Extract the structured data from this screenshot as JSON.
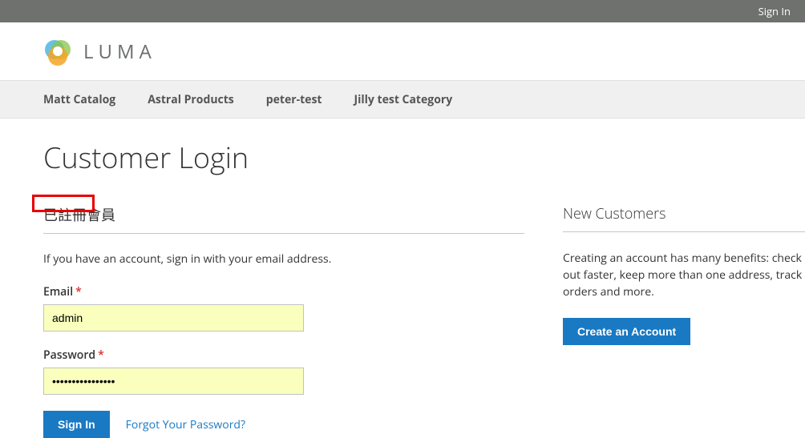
{
  "topbar": {
    "signin": "Sign In"
  },
  "brand": {
    "name": "LUMA"
  },
  "nav": {
    "items": [
      {
        "label": "Matt Catalog"
      },
      {
        "label": "Astral Products"
      },
      {
        "label": "peter-test"
      },
      {
        "label": "Jilly test Category"
      }
    ]
  },
  "page": {
    "title": "Customer Login"
  },
  "login": {
    "heading": "已註冊會員",
    "note": "If you have an account, sign in with your email address.",
    "email_label": "Email",
    "email_value": "admin",
    "password_label": "Password",
    "password_value": "••••••••••••••••",
    "signin_btn": "Sign In",
    "forgot": "Forgot Your Password?"
  },
  "new": {
    "heading": "New Customers",
    "note": "Creating an account has many benefits: check out faster, keep more than one address, track orders and more.",
    "create_btn": "Create an Account"
  }
}
